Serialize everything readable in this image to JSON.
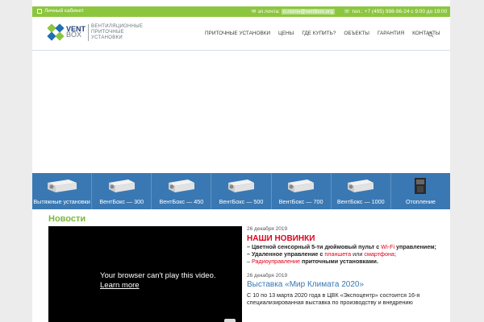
{
  "topbar": {
    "cabinet": "Личный кабинет",
    "email_label": "эл.почта:",
    "email": "n.rozov@ventbox.org",
    "phone": "тел.: +7 (495) 998-96-24 с 9:00 до 19:00"
  },
  "logo": {
    "brand_top": "VENT",
    "brand_bottom": "BOX",
    "tagline_1": "ВЕНТИЛЯЦИОННЫЕ",
    "tagline_2": "ПРИТОЧНЫЕ",
    "tagline_3": "УСТАНОВКИ"
  },
  "nav": [
    "ПРИТОЧНЫЕ УСТАНОВКИ",
    "ЦЕНЫ",
    "ГДЕ КУПИТЬ?",
    "ОБЪЕКТЫ",
    "ГАРАНТИЯ",
    "КОНТАКТЫ"
  ],
  "products": [
    "Вытяжные установки",
    "ВентБокс — 300",
    "ВентБокс — 450",
    "ВентБокс — 500",
    "ВентБокс — 700",
    "ВентБокс — 1000",
    "Отопление"
  ],
  "news": {
    "heading": "Новости",
    "video": {
      "line1": "Your browser can't play this video.",
      "line2": "Learn more"
    },
    "item1": {
      "date": "26 декабря 2019",
      "title": "НАШИ НОВИНКИ",
      "b1_a": "– Цветной сенсорный 5-ти дюймовый пульт с ",
      "b1_b": "Wi-Fi",
      "b1_c": " управлением;",
      "b2_a": "– Удаленное управление с ",
      "b2_b": "планшета",
      "b2_c": " или ",
      "b2_d": "смартфона",
      "b2_e": ";",
      "b3_a": "– ",
      "b3_b": "Радиоуправление",
      "b3_c": " приточными установками."
    },
    "item2": {
      "date": "26 декабря 2019",
      "title": "Выставка «Мир Климата 2020»",
      "text": "С 10 по 13 марта 2020 года в ЦВК «Экспоцентр» состоится 16-я специализированная выставка по производству и внедрению"
    }
  },
  "colors": {
    "topbar": "#8cc63f",
    "products_bar": "#3a78b3",
    "news_heading": "#7ab83a",
    "accent_red": "#e0001a"
  }
}
